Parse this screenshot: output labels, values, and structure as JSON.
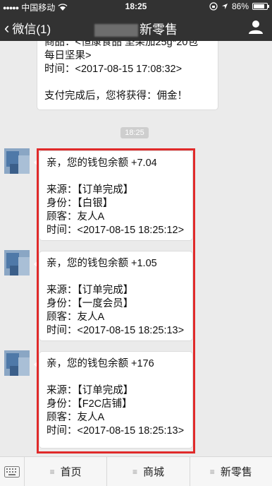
{
  "status_bar": {
    "carrier": "中国移动",
    "time": "18:25",
    "battery": "86%",
    "battery_level": 0.86
  },
  "nav": {
    "back_label": "微信(1)",
    "title": "新零售"
  },
  "chat": {
    "top_message": {
      "lines": [
        "商品：<恒康食品 坚果加25g*20包",
        "每日坚果>",
        "时间：<2017-08-15 17:08:32>",
        "",
        "支付完成后，您将获得：佣金！"
      ]
    },
    "time_separator": "18:25",
    "messages": [
      {
        "lines": [
          "亲，您的钱包余额 +7.04",
          "",
          "来源：【订单完成】",
          "身份：【白银】",
          "顾客：友人A",
          "时间：<2017-08-15 18:25:12>"
        ]
      },
      {
        "lines": [
          "亲，您的钱包余额 +1.05",
          "",
          "来源：【订单完成】",
          "身份：【一度会员】",
          "顾客：友人A",
          "时间：<2017-08-15 18:25:13>"
        ]
      },
      {
        "lines": [
          "亲，您的钱包余额 +176",
          "",
          "来源：【订单完成】",
          "身份：【F2C店铺】",
          "顾客：友人A",
          "时间：<2017-08-15 18:25:13>"
        ]
      }
    ]
  },
  "bottom_menu": {
    "items": [
      "首页",
      "商城",
      "新零售"
    ]
  },
  "icons": {
    "back": "chevron-left-icon",
    "profile": "person-icon",
    "keyboard": "keyboard-icon",
    "wifi": "wifi-icon",
    "location": "location-icon"
  },
  "colors": {
    "header_bg": "#323232",
    "chat_bg": "#ebebeb",
    "highlight": "#e02a2a"
  }
}
